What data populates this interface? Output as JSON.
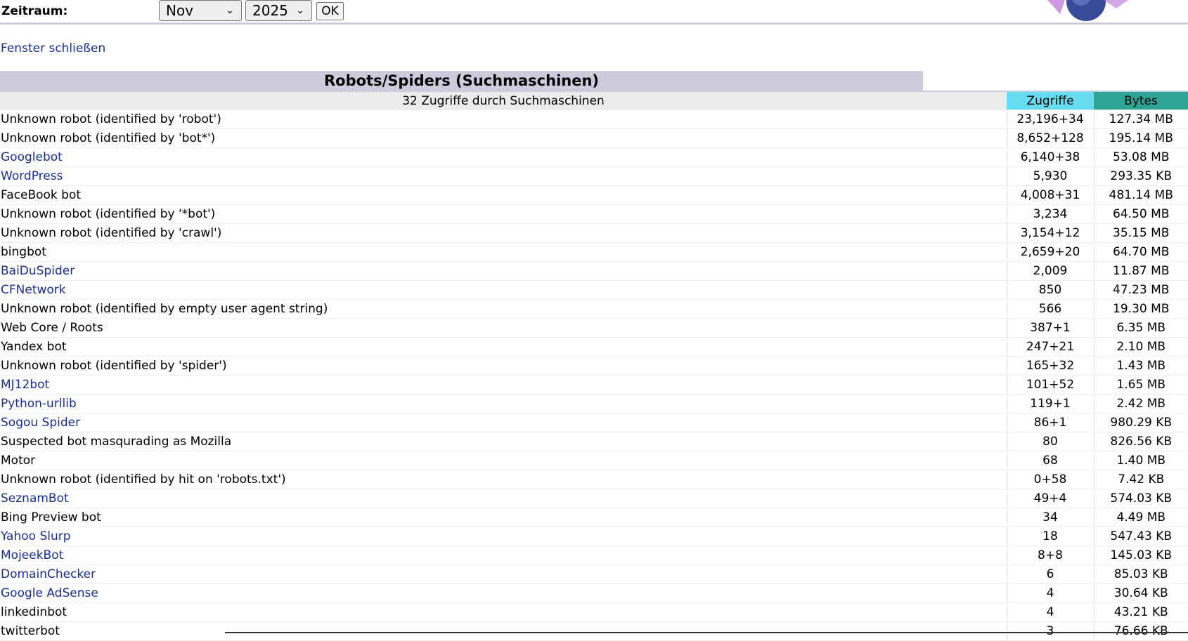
{
  "toolbar": {
    "period_label": "Zeitraum:",
    "month_value": "Nov",
    "year_value": "2025",
    "ok_label": "OK"
  },
  "close_window_link": "Fenster schließen",
  "section_title": "Robots/Spiders (Suchmaschinen)",
  "table": {
    "summary": "32 Zugriffe durch Suchmaschinen",
    "col_hits": "Zugriffe",
    "col_bytes": "Bytes",
    "rows": [
      {
        "name": "Unknown robot (identified by 'robot')",
        "link": false,
        "hits": "23,196+34",
        "bytes": "127.34 MB"
      },
      {
        "name": "Unknown robot (identified by 'bot*')",
        "link": false,
        "hits": "8,652+128",
        "bytes": "195.14 MB"
      },
      {
        "name": "Googlebot",
        "link": true,
        "hits": "6,140+38",
        "bytes": "53.08 MB"
      },
      {
        "name": "WordPress",
        "link": true,
        "hits": "5,930",
        "bytes": "293.35 KB"
      },
      {
        "name": "FaceBook bot",
        "link": false,
        "hits": "4,008+31",
        "bytes": "481.14 MB"
      },
      {
        "name": "Unknown robot (identified by '*bot')",
        "link": false,
        "hits": "3,234",
        "bytes": "64.50 MB"
      },
      {
        "name": "Unknown robot (identified by 'crawl')",
        "link": false,
        "hits": "3,154+12",
        "bytes": "35.15 MB"
      },
      {
        "name": "bingbot",
        "link": false,
        "hits": "2,659+20",
        "bytes": "64.70 MB"
      },
      {
        "name": "BaiDuSpider",
        "link": true,
        "hits": "2,009",
        "bytes": "11.87 MB"
      },
      {
        "name": "CFNetwork",
        "link": true,
        "hits": "850",
        "bytes": "47.23 MB"
      },
      {
        "name": "Unknown robot (identified by empty user agent string)",
        "link": false,
        "hits": "566",
        "bytes": "19.30 MB"
      },
      {
        "name": "Web Core / Roots",
        "link": false,
        "hits": "387+1",
        "bytes": "6.35 MB"
      },
      {
        "name": "Yandex bot",
        "link": false,
        "hits": "247+21",
        "bytes": "2.10 MB"
      },
      {
        "name": "Unknown robot (identified by 'spider')",
        "link": false,
        "hits": "165+32",
        "bytes": "1.43 MB"
      },
      {
        "name": "MJ12bot",
        "link": true,
        "hits": "101+52",
        "bytes": "1.65 MB"
      },
      {
        "name": "Python-urllib",
        "link": true,
        "hits": "119+1",
        "bytes": "2.42 MB"
      },
      {
        "name": "Sogou Spider",
        "link": true,
        "hits": "86+1",
        "bytes": "980.29 KB"
      },
      {
        "name": "Suspected bot masqurading as Mozilla",
        "link": false,
        "hits": "80",
        "bytes": "826.56 KB"
      },
      {
        "name": "Motor",
        "link": false,
        "hits": "68",
        "bytes": "1.40 MB"
      },
      {
        "name": "Unknown robot (identified by hit on 'robots.txt')",
        "link": false,
        "hits": "0+58",
        "bytes": "7.42 KB"
      },
      {
        "name": "SeznamBot",
        "link": true,
        "hits": "49+4",
        "bytes": "574.03 KB"
      },
      {
        "name": "Bing Preview bot",
        "link": false,
        "hits": "34",
        "bytes": "4.49 MB"
      },
      {
        "name": "Yahoo Slurp",
        "link": true,
        "hits": "18",
        "bytes": "547.43 KB"
      },
      {
        "name": "MojeekBot",
        "link": true,
        "hits": "8+8",
        "bytes": "145.03 KB"
      },
      {
        "name": "DomainChecker",
        "link": true,
        "hits": "6",
        "bytes": "85.03 KB"
      },
      {
        "name": "Google AdSense",
        "link": true,
        "hits": "4",
        "bytes": "30.64 KB"
      },
      {
        "name": "linkedinbot",
        "link": false,
        "hits": "4",
        "bytes": "43.21 KB"
      },
      {
        "name": "twitterbot",
        "link": false,
        "hits": "3",
        "bytes": "76.66 KB"
      }
    ]
  },
  "colors": {
    "link": "#1a2d9c",
    "title_bg": "#ccccdd",
    "hits_header_bg": "#66ddee",
    "bytes_header_bg": "#2ea495"
  }
}
